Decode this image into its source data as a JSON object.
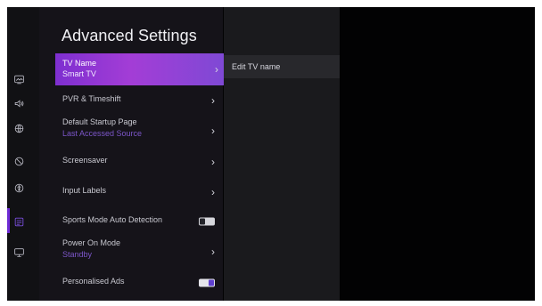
{
  "menu": {
    "title": "Advanced Settings",
    "items": [
      {
        "label": "TV Name",
        "sub": "Smart TV",
        "type": "chevron"
      },
      {
        "label": "PVR & Timeshift",
        "type": "chevron"
      },
      {
        "label": "Default Startup Page",
        "sub": "Last Accessed Source",
        "type": "chevron"
      },
      {
        "label": "Screensaver",
        "type": "chevron"
      },
      {
        "label": "Input Labels",
        "type": "chevron"
      },
      {
        "label": "Sports Mode Auto Detection",
        "type": "toggle",
        "state": "off"
      },
      {
        "label": "Power On Mode",
        "sub": "Standby",
        "type": "chevron"
      },
      {
        "label": "Personalised Ads",
        "type": "toggle",
        "state": "on"
      }
    ]
  },
  "detail": {
    "items": [
      {
        "label": "Edit TV name"
      }
    ]
  },
  "rail": {
    "icons": [
      "picture-icon",
      "sound-icon",
      "network-icon",
      "restrictions-icon",
      "accessibility-icon",
      "system-icon",
      "support-icon"
    ]
  },
  "colors": {
    "accent": "#7e2fd0",
    "highlight": "#a33dd6",
    "subtext": "#7c56c9",
    "background": "#020203"
  }
}
